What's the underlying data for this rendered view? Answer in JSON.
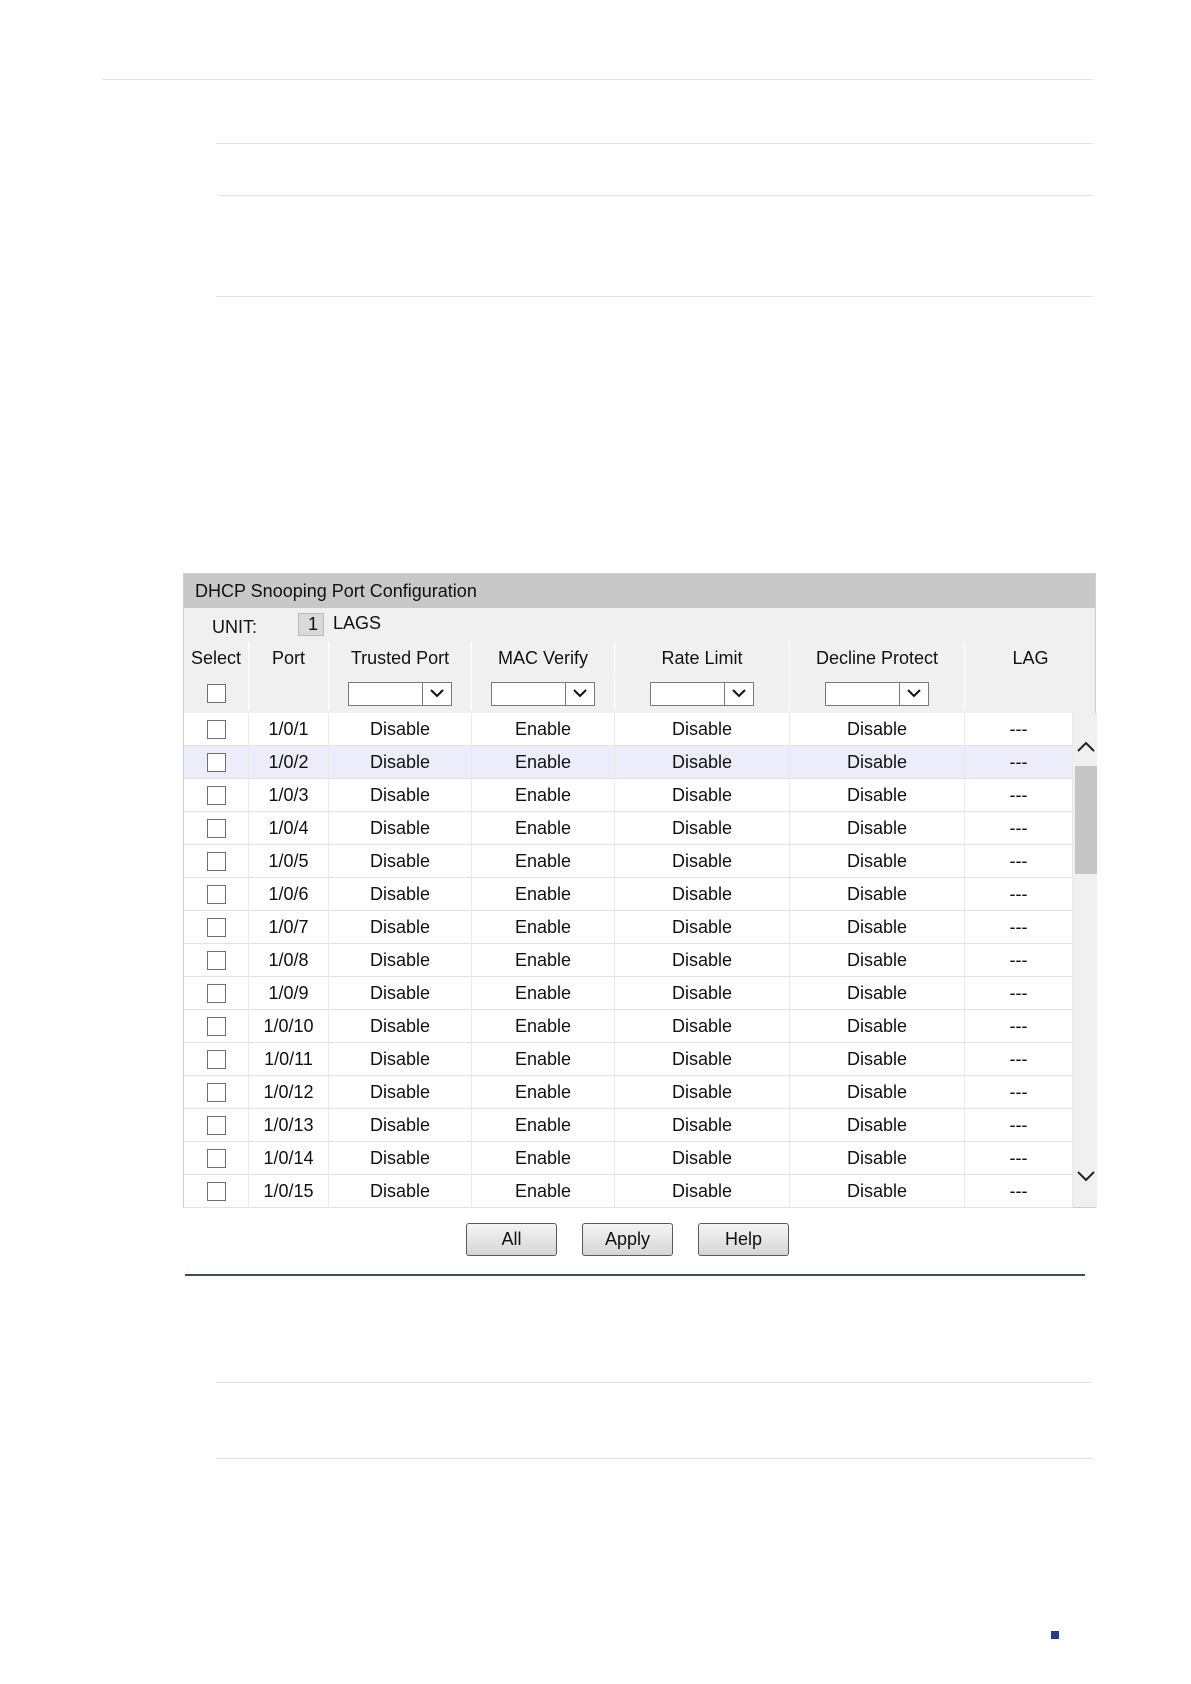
{
  "panel": {
    "title": "DHCP Snooping Port Configuration",
    "unit_label": "UNIT:",
    "unit_value": "1",
    "lags_label": "LAGS"
  },
  "columns": [
    "Select",
    "Port",
    "Trusted Port",
    "MAC Verify",
    "Rate Limit",
    "Decline Protect",
    "LAG"
  ],
  "rows": [
    {
      "port": "1/0/1",
      "trusted": "Disable",
      "mac": "Enable",
      "rate": "Disable",
      "decline": "Disable",
      "lag": "---"
    },
    {
      "port": "1/0/2",
      "trusted": "Disable",
      "mac": "Enable",
      "rate": "Disable",
      "decline": "Disable",
      "lag": "---"
    },
    {
      "port": "1/0/3",
      "trusted": "Disable",
      "mac": "Enable",
      "rate": "Disable",
      "decline": "Disable",
      "lag": "---"
    },
    {
      "port": "1/0/4",
      "trusted": "Disable",
      "mac": "Enable",
      "rate": "Disable",
      "decline": "Disable",
      "lag": "---"
    },
    {
      "port": "1/0/5",
      "trusted": "Disable",
      "mac": "Enable",
      "rate": "Disable",
      "decline": "Disable",
      "lag": "---"
    },
    {
      "port": "1/0/6",
      "trusted": "Disable",
      "mac": "Enable",
      "rate": "Disable",
      "decline": "Disable",
      "lag": "---"
    },
    {
      "port": "1/0/7",
      "trusted": "Disable",
      "mac": "Enable",
      "rate": "Disable",
      "decline": "Disable",
      "lag": "---"
    },
    {
      "port": "1/0/8",
      "trusted": "Disable",
      "mac": "Enable",
      "rate": "Disable",
      "decline": "Disable",
      "lag": "---"
    },
    {
      "port": "1/0/9",
      "trusted": "Disable",
      "mac": "Enable",
      "rate": "Disable",
      "decline": "Disable",
      "lag": "---"
    },
    {
      "port": "1/0/10",
      "trusted": "Disable",
      "mac": "Enable",
      "rate": "Disable",
      "decline": "Disable",
      "lag": "---"
    },
    {
      "port": "1/0/11",
      "trusted": "Disable",
      "mac": "Enable",
      "rate": "Disable",
      "decline": "Disable",
      "lag": "---"
    },
    {
      "port": "1/0/12",
      "trusted": "Disable",
      "mac": "Enable",
      "rate": "Disable",
      "decline": "Disable",
      "lag": "---"
    },
    {
      "port": "1/0/13",
      "trusted": "Disable",
      "mac": "Enable",
      "rate": "Disable",
      "decline": "Disable",
      "lag": "---"
    },
    {
      "port": "1/0/14",
      "trusted": "Disable",
      "mac": "Enable",
      "rate": "Disable",
      "decline": "Disable",
      "lag": "---"
    },
    {
      "port": "1/0/15",
      "trusted": "Disable",
      "mac": "Enable",
      "rate": "Disable",
      "decline": "Disable",
      "lag": "---"
    }
  ],
  "highlighted_row": "1/0/2",
  "buttons": {
    "all": "All",
    "apply": "Apply",
    "help": "Help"
  },
  "colors": {
    "title_bar": "#c8c8c8",
    "panel_bg": "#f0f0f0",
    "row_highlight": "#ececfa",
    "divider": "#3d4f5c",
    "page_marker": "#2b3990"
  }
}
